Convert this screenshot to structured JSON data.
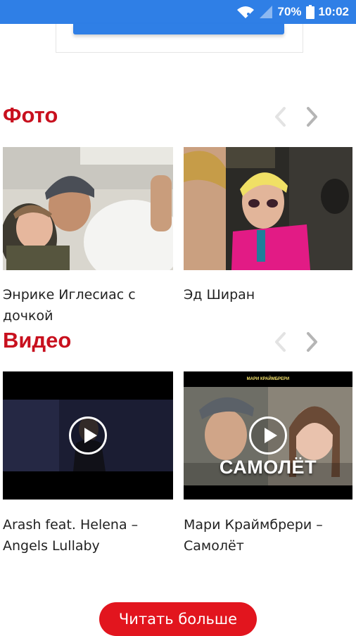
{
  "status_bar": {
    "battery_percent": "70%",
    "time": "10:02"
  },
  "photo_section": {
    "title": "Фото",
    "items": [
      {
        "caption": "Энрике Иглесиас с дочкой"
      },
      {
        "caption": "Эд Ширан"
      }
    ]
  },
  "video_section": {
    "title": "Видео",
    "items": [
      {
        "caption": "Arash feat. Helena – Angels Lullaby"
      },
      {
        "caption": "Мари Краймбрери – Самолёт",
        "overlay_title": "САМОЛЁТ",
        "overlay_sub": "МАРИ КРАЙМБРЕРИ"
      }
    ]
  },
  "more_button": {
    "label": "Читать больше"
  },
  "colors": {
    "accent": "#c8101e",
    "button": "#e2151e",
    "statusbar": "#2f7fe6"
  },
  "icons": [
    "wifi-icon",
    "signal-icon",
    "battery-icon",
    "chevron-left-icon",
    "chevron-right-icon",
    "play-icon"
  ]
}
